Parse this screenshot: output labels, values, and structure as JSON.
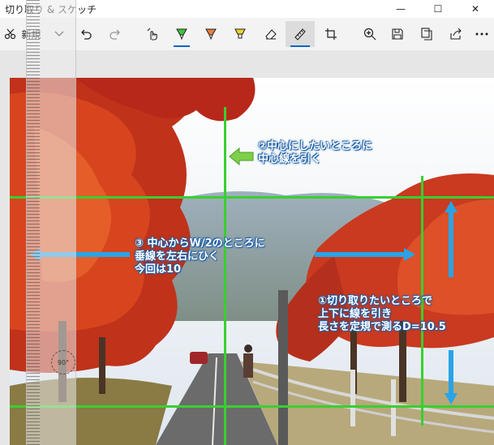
{
  "window": {
    "title": "切り取り & スケッチ"
  },
  "toolbar": {
    "new_label": "新規",
    "icons": [
      "snip-icon",
      "chevron-down-icon",
      "undo-icon",
      "redo-icon",
      "touch-writing-icon",
      "ballpoint-pen-icon",
      "pencil-icon",
      "highlighter-icon",
      "eraser-icon",
      "ruler-icon",
      "crop-icon",
      "zoom-in-icon",
      "save-icon",
      "copy-icon",
      "share-icon",
      "more-icon"
    ]
  },
  "ruler": {
    "angle_label": "90°"
  },
  "annotations": {
    "center_line": [
      "②中心にしたいところに",
      "中心線を引く"
    ],
    "vertical_line": [
      "③ 中心からW/2のところに",
      "垂線を左右にひく",
      "今回は10"
    ],
    "measure": [
      "①切り取りたいところで",
      "上下に線を引き",
      "長さを定規で測るD=10.5"
    ]
  },
  "colors": {
    "guide_line": "#38d030",
    "arrow": "#29a3e8",
    "arrow_green": "#7fcf4a",
    "text_outline": "#1b5fa8",
    "pen_green": "#3ec43e",
    "pen_orange": "#e8803a",
    "pen_yellow": "#f2d22e"
  }
}
